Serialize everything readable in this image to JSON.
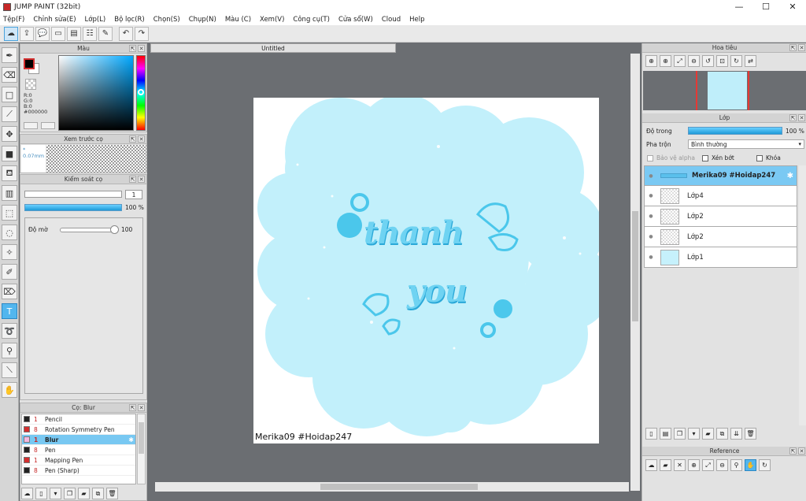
{
  "window": {
    "title": "JUMP PAINT (32bit)",
    "minimize_glyph": "—",
    "maximize_glyph": "☐",
    "close_glyph": "✕"
  },
  "menu": [
    "Tệp(F)",
    "Chỉnh sửa(E)",
    "Lớp(L)",
    "Bộ lọc(R)",
    "Chọn(S)",
    "Chụp(N)",
    "Màu (C)",
    "Xem(V)",
    "Công cụ(T)",
    "Cửa sổ(W)",
    "Cloud",
    "Help"
  ],
  "toolbar_icons": [
    "cloud-sync-icon",
    "export-icon",
    "comment-icon",
    "screen-icon",
    "page-icon",
    "layer-property-icon",
    "edit-icon",
    "undo-icon",
    "redo-icon"
  ],
  "left_tools": [
    "pen-icon",
    "eraser-icon",
    "shape-rect-icon",
    "line-tool-icon",
    "move-icon",
    "fill-rect-icon",
    "bucket-icon",
    "gradient-icon",
    "select-rect-icon",
    "select-lasso-icon",
    "magic-wand-icon",
    "select-pen-icon",
    "select-eraser-icon",
    "text-icon",
    "lasso-fill-icon",
    "eyedropper-icon",
    "ruler-icon",
    "hand-icon"
  ],
  "color_panel": {
    "title": "Màu",
    "r": "R:0",
    "g": "G:0",
    "b": "B:0",
    "hex": "#000000",
    "fg_color": "#000000",
    "bg_color": "#ffffff"
  },
  "brush_preview": {
    "title": "Xem trước cọ",
    "size_label": "* 0.07mm"
  },
  "brush_control": {
    "title": "Kiểm soát cọ",
    "size_value": "1",
    "opacity_value": "100 %",
    "do_mo_label": "Độ mờ",
    "do_mo_value": "100"
  },
  "brush_list": {
    "title": "Cọ: Blur",
    "items": [
      {
        "size": "1",
        "name": "Pencil",
        "color": "#222222"
      },
      {
        "size": "8",
        "name": "Rotation Symmetry Pen",
        "color": "#d32f2f"
      },
      {
        "size": "1",
        "name": "Blur",
        "color": "#f5b7e1"
      },
      {
        "size": "8",
        "name": "Pen",
        "color": "#222222"
      },
      {
        "size": "1",
        "name": "Mapping Pen",
        "color": "#d32f2f"
      },
      {
        "size": "8",
        "name": "Pen (Sharp)",
        "color": "#222222"
      }
    ],
    "selected_index": 2
  },
  "canvas": {
    "tab_title": "Untitled",
    "signature": "Merika09 #Hoidap247",
    "artwork_text": "thanh you",
    "cloud_color": "#c2f0fb",
    "accent_color": "#3fc3ea"
  },
  "navigator": {
    "title": "Hoa tiêu"
  },
  "layer_panel": {
    "title": "Lớp",
    "opacity_label": "Độ trong",
    "opacity_value": "100 %",
    "blend_label": "Pha trộn",
    "blend_value": "Bình thường",
    "protect_alpha": "Bảo vệ alpha",
    "clipping": "Xén bớt",
    "lock": "Khóa",
    "layers": [
      {
        "name": "Merika09 #Hoidap247",
        "selected": true
      },
      {
        "name": "Lớp4",
        "selected": false
      },
      {
        "name": "Lớp2",
        "selected": false
      },
      {
        "name": "Lớp2",
        "selected": false
      },
      {
        "name": "Lớp1",
        "selected": false
      }
    ]
  },
  "reference_panel": {
    "title": "Reference"
  }
}
